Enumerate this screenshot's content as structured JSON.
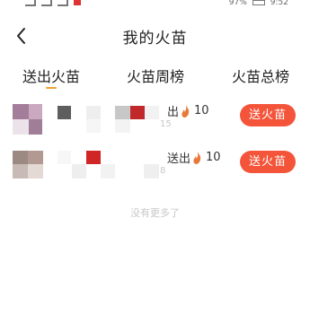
{
  "status_bar": {
    "battery_text": "97%",
    "time": "9:52"
  },
  "header": {
    "title": "我的火苗",
    "back_icon": "chevron-left-icon"
  },
  "tabs": [
    {
      "label": "送出火苗",
      "active": true
    },
    {
      "label": "火苗周榜",
      "active": false
    },
    {
      "label": "火苗总榜",
      "active": false
    }
  ],
  "list": [
    {
      "action_text": "出",
      "count": "10",
      "sub_text": "15",
      "button_label": "送火苗"
    },
    {
      "action_text": "送出",
      "count": "10",
      "sub_text": "8",
      "button_label": "送火苗"
    }
  ],
  "footer": {
    "no_more_text": "没有更多了"
  },
  "colors": {
    "accent": "#f4553a",
    "tab_indicator": "#f0a030",
    "flame": "#e8783a"
  }
}
